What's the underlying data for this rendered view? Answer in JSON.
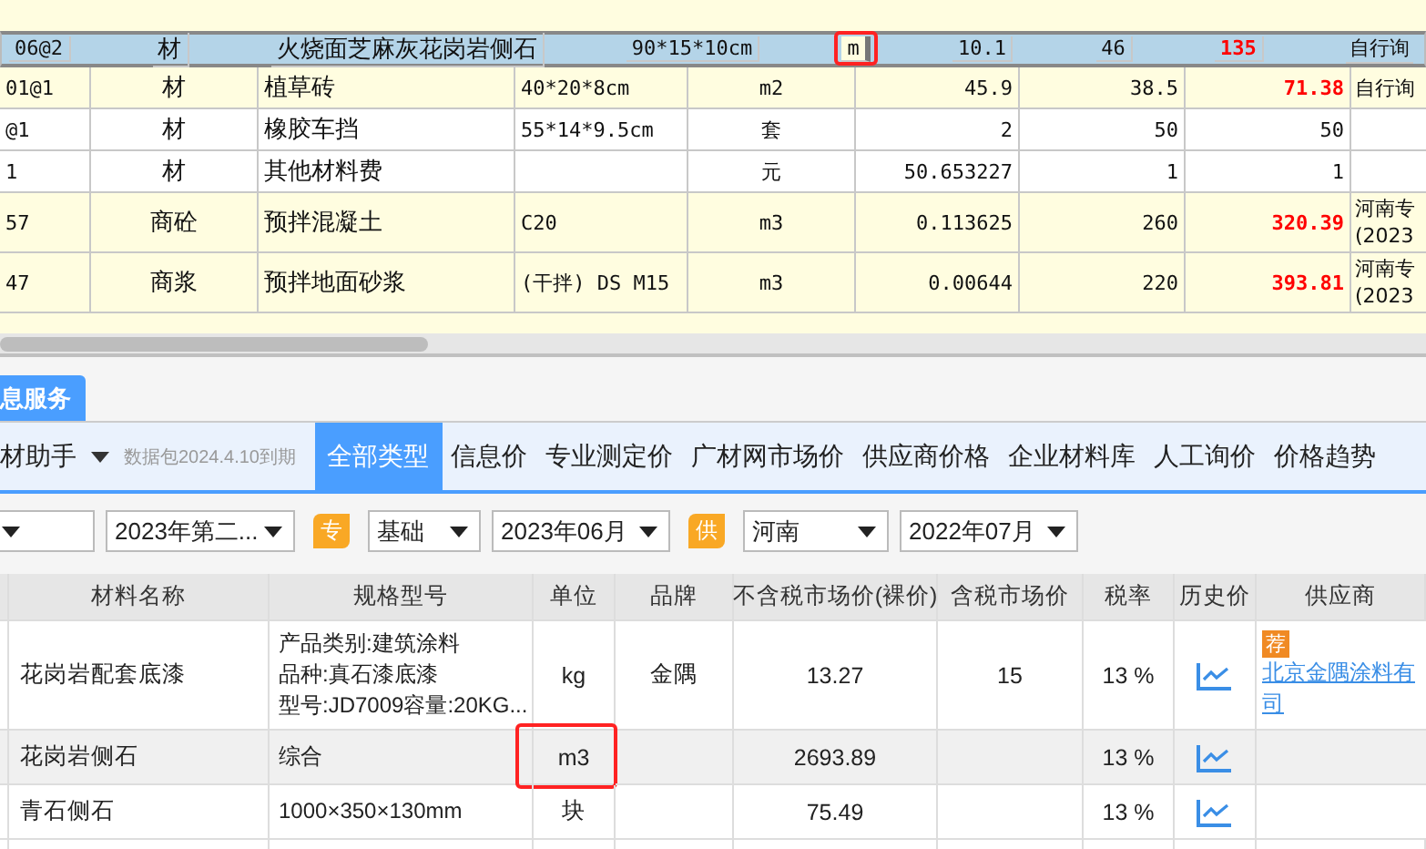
{
  "top_table": {
    "rows": [
      {
        "code": "06@2",
        "type": "材",
        "name": "火烧面芝麻灰花岗岩侧石",
        "spec": "90*15*10cm",
        "unit": "m",
        "qty": "10.1",
        "price": "46",
        "total": "135",
        "total_red": true,
        "source": [
          "自行询"
        ],
        "shaded": true,
        "selected": true,
        "highlighted": true
      },
      {
        "code": "01@1",
        "type": "材",
        "name": "植草砖",
        "spec": "40*20*8cm",
        "unit": "m2",
        "qty": "45.9",
        "price": "38.5",
        "total": "71.38",
        "total_red": true,
        "source": [
          "自行询"
        ],
        "shaded": true,
        "selected": false,
        "highlighted": false
      },
      {
        "code": "@1",
        "type": "材",
        "name": "橡胶车挡",
        "spec": "55*14*9.5cm",
        "unit": "套",
        "qty": "2",
        "price": "50",
        "total": "50",
        "total_red": false,
        "source": [],
        "shaded": false,
        "selected": false,
        "highlighted": false
      },
      {
        "code": "1",
        "type": "材",
        "name": "其他材料费",
        "spec": "",
        "unit": "元",
        "qty": "50.653227",
        "price": "1",
        "total": "1",
        "total_red": false,
        "source": [],
        "shaded": false,
        "selected": false,
        "highlighted": false
      },
      {
        "code": "57",
        "type": "商砼",
        "name": "预拌混凝土",
        "spec": "C20",
        "unit": "m3",
        "qty": "0.113625",
        "price": "260",
        "total": "320.39",
        "total_red": true,
        "source": [
          "河南专",
          "(2023"
        ],
        "shaded": true,
        "selected": false,
        "highlighted": false
      },
      {
        "code": "47",
        "type": "商浆",
        "name": "预拌地面砂浆",
        "spec": "(干拌) DS M15",
        "unit": "m3",
        "qty": "0.00644",
        "price": "220",
        "total": "393.81",
        "total_red": true,
        "source": [
          "河南专",
          "(2023"
        ],
        "shaded": true,
        "selected": false,
        "highlighted": false
      }
    ]
  },
  "panel_tab": "息服务",
  "toolbar": {
    "assistant": "材助手",
    "notice": "数据包2024.4.10到期",
    "tabs": [
      {
        "label": "全部类型",
        "selected": true
      },
      {
        "label": "信息价",
        "selected": false
      },
      {
        "label": "专业测定价",
        "selected": false
      },
      {
        "label": "广材网市场价",
        "selected": false
      },
      {
        "label": "供应商价格",
        "selected": false
      },
      {
        "label": "企业材料库",
        "selected": false
      },
      {
        "label": "人工询价",
        "selected": false
      },
      {
        "label": "价格趋势",
        "selected": false
      }
    ]
  },
  "filters": [
    {
      "kind": "select"
    },
    {
      "kind": "select",
      "value": "2023年第二..."
    },
    {
      "kind": "badge",
      "value": "专"
    },
    {
      "kind": "select",
      "value": "基础"
    },
    {
      "kind": "select",
      "value": "2023年06月"
    },
    {
      "kind": "badge",
      "value": "供"
    },
    {
      "kind": "select",
      "value": "河南"
    },
    {
      "kind": "select",
      "value": "2022年07月"
    }
  ],
  "price_table": {
    "columns": [
      "材料名称",
      "规格型号",
      "单位",
      "品牌",
      "不含税市场价(裸价)",
      "含税市场价",
      "税率",
      "历史价",
      "供应商"
    ],
    "rows": [
      {
        "name": "花岗岩配套底漆",
        "spec": [
          "产品类别:建筑涂料",
          "品种:真石漆底漆",
          "型号:JD7009容量:20KG..."
        ],
        "unit": "kg",
        "brand": "金隅",
        "price_ex": "13.27",
        "price_inc": "15",
        "tax": "13 %",
        "supplier": {
          "badge": "荐",
          "lines": [
            "北京金隅涂料有",
            "司"
          ]
        },
        "selected": false,
        "highlighted": false
      },
      {
        "name": "花岗岩侧石",
        "spec": [
          "综合"
        ],
        "unit": "m3",
        "brand": "",
        "price_ex": "2693.89",
        "price_inc": "",
        "tax": "13 %",
        "selected": true,
        "highlighted": true
      },
      {
        "name": "青石侧石",
        "spec": [
          "1000×350×130mm"
        ],
        "unit": "块",
        "brand": "",
        "price_ex": "75.49",
        "price_inc": "",
        "tax": "13 %",
        "selected": false,
        "highlighted": false
      }
    ]
  }
}
